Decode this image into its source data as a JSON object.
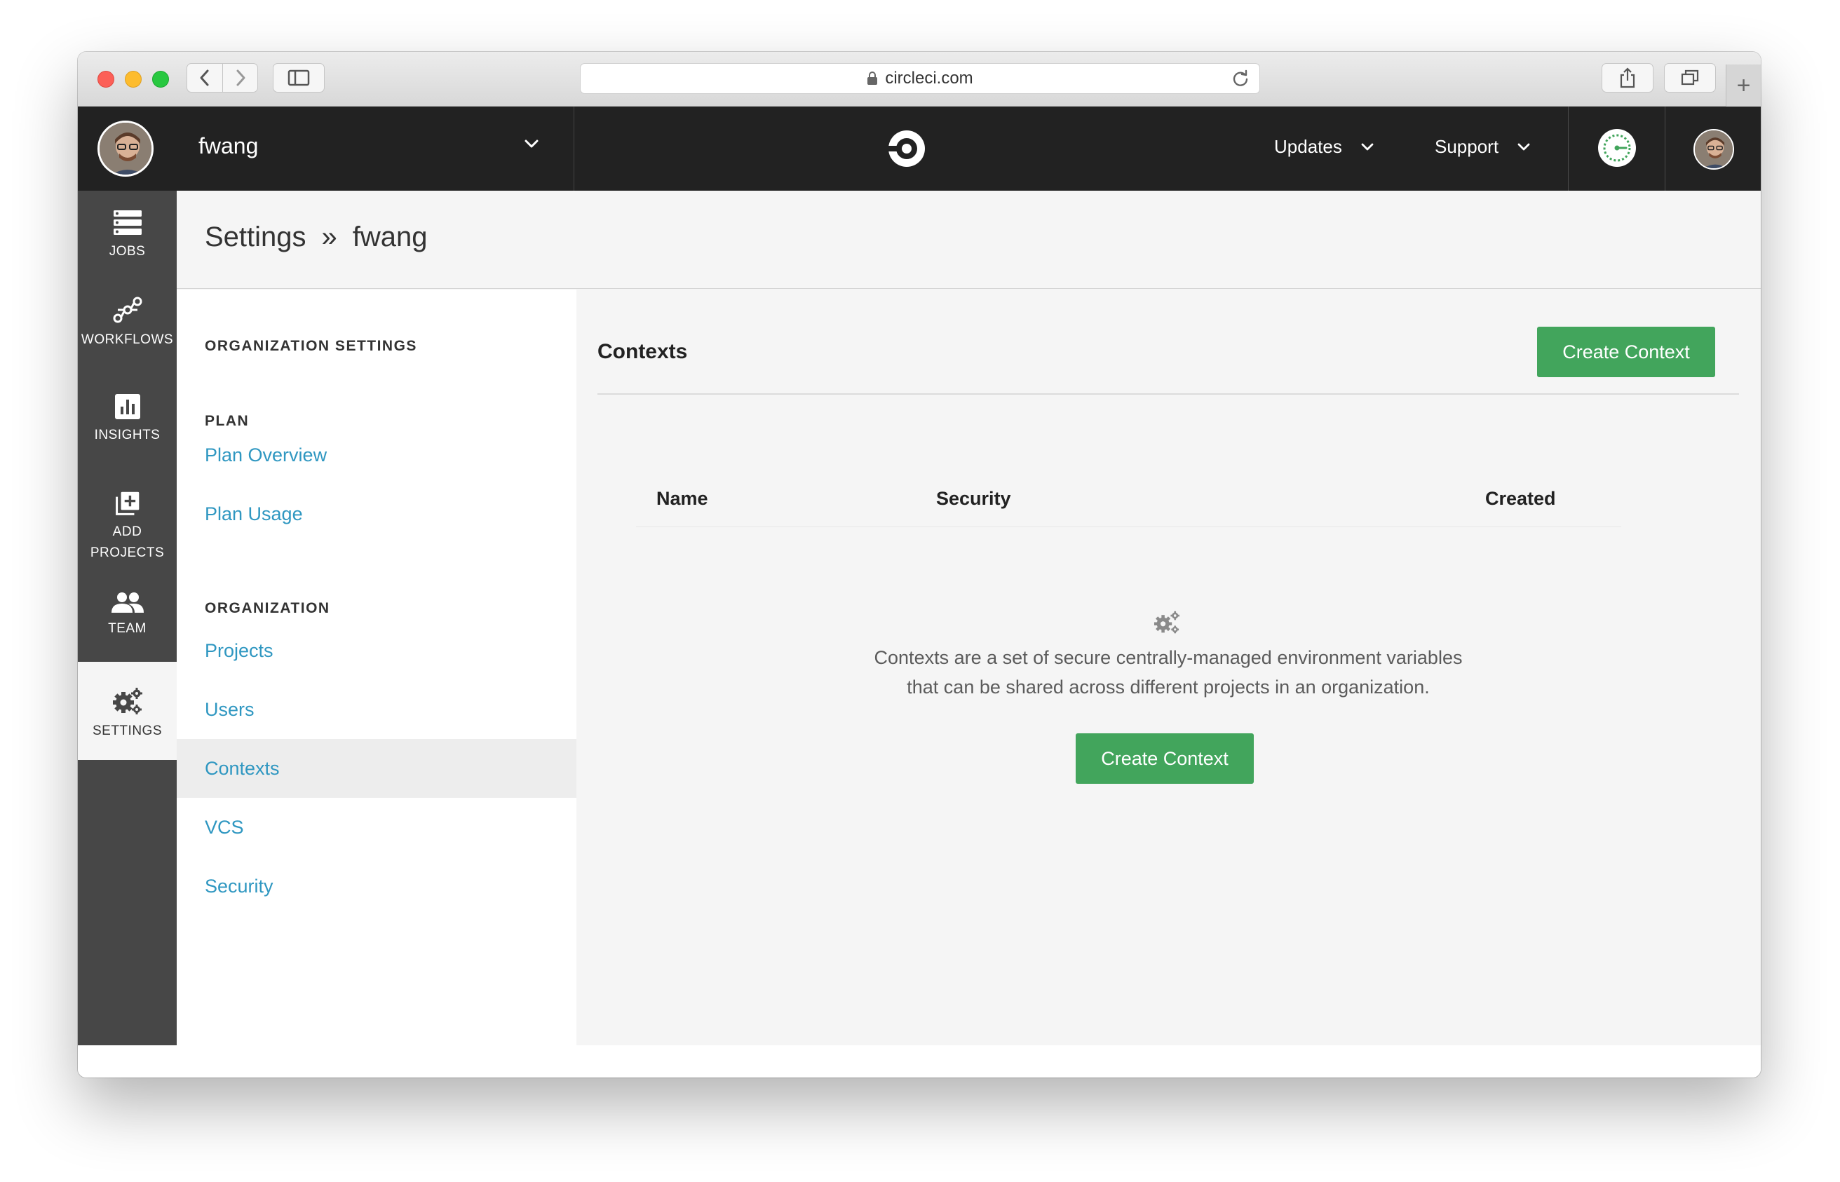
{
  "browser": {
    "url": "circleci.com"
  },
  "topnav": {
    "org_name": "fwang",
    "updates_label": "Updates",
    "support_label": "Support"
  },
  "leftnav": {
    "items": [
      {
        "label": "JOBS",
        "icon": "jobs-icon"
      },
      {
        "label": "WORKFLOWS",
        "icon": "workflows-icon"
      },
      {
        "label": "INSIGHTS",
        "icon": "insights-icon"
      },
      {
        "label_line1": "ADD",
        "label_line2": "PROJECTS",
        "icon": "add-projects-icon"
      },
      {
        "label": "TEAM",
        "icon": "team-icon"
      },
      {
        "label": "SETTINGS",
        "icon": "settings-icon",
        "active": true
      }
    ]
  },
  "breadcrumb": {
    "root": "Settings",
    "separator": "»",
    "current": "fwang"
  },
  "settings_menu": {
    "section_title": "ORGANIZATION SETTINGS",
    "groups": [
      {
        "title": "PLAN",
        "links": [
          "Plan Overview",
          "Plan Usage"
        ]
      },
      {
        "title": "ORGANIZATION",
        "links": [
          "Projects",
          "Users",
          "Contexts",
          "VCS",
          "Security"
        ]
      }
    ],
    "active_link": "Contexts"
  },
  "main": {
    "title": "Contexts",
    "create_button": "Create Context",
    "table_headers": [
      "Name",
      "Security",
      "Created"
    ],
    "empty_line1": "Contexts are a set of secure centrally-managed environment variables",
    "empty_line2": "that can be shared across different projects in an organization.",
    "empty_button": "Create Context"
  },
  "colors": {
    "nav_dark": "#222222",
    "sidebar": "#474747",
    "accent_green": "#42a55c",
    "link_blue": "#2f97c1"
  }
}
